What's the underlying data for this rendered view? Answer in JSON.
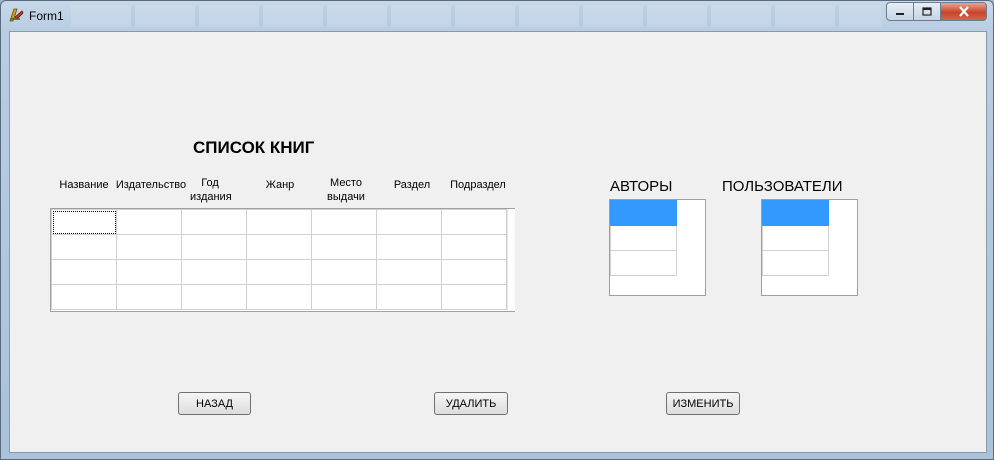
{
  "window": {
    "title": "Form1"
  },
  "books": {
    "title": "СПИСОК КНИГ",
    "columns": [
      {
        "line1": "",
        "line2": "Название"
      },
      {
        "line1": "",
        "line2": "Издательство"
      },
      {
        "line1": "Год",
        "line2": "издания"
      },
      {
        "line1": "",
        "line2": "Жанр"
      },
      {
        "line1": "Место",
        "line2": "выдачи"
      },
      {
        "line1": "",
        "line2": "Раздел"
      },
      {
        "line1": "",
        "line2": "Подраздел"
      }
    ],
    "rows": 4
  },
  "authors": {
    "title": "АВТОРЫ"
  },
  "users": {
    "title": "ПОЛЬЗОВАТЕЛИ"
  },
  "buttons": {
    "back": "НАЗАД",
    "delete": "УДАЛИТЬ",
    "edit": "ИЗМЕНИТЬ"
  }
}
